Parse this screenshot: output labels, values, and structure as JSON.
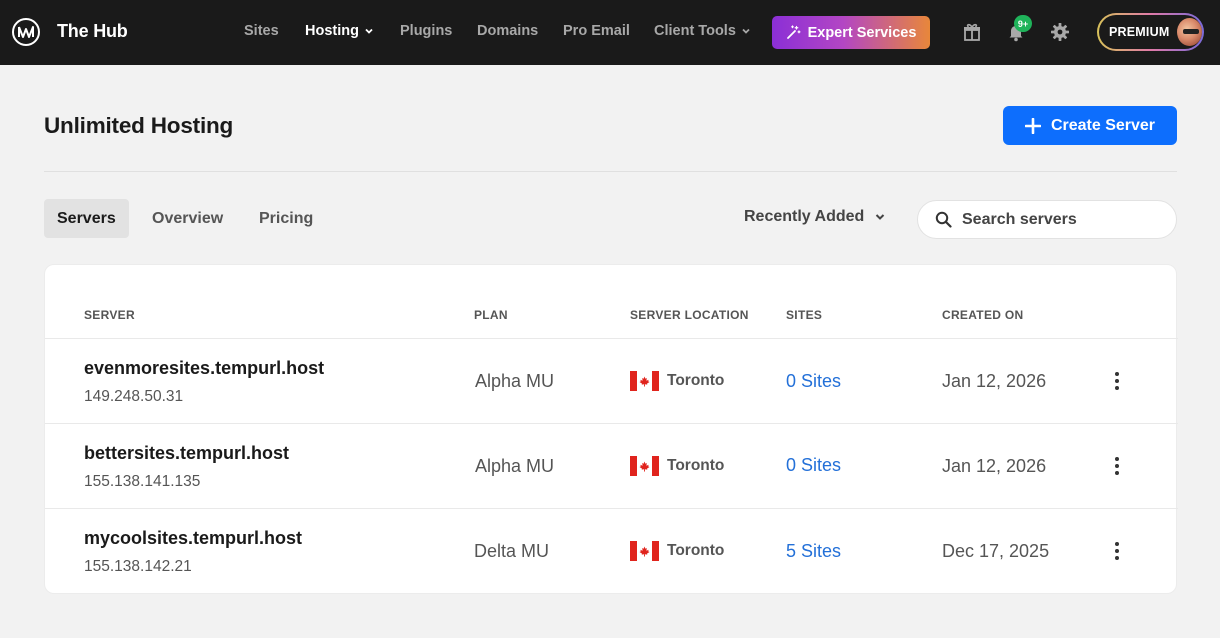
{
  "app": {
    "name": "The Hub"
  },
  "nav": {
    "items": [
      {
        "label": "Sites",
        "active": false,
        "dropdown": false
      },
      {
        "label": "Hosting",
        "active": true,
        "dropdown": true
      },
      {
        "label": "Plugins",
        "active": false,
        "dropdown": false
      },
      {
        "label": "Domains",
        "active": false,
        "dropdown": false
      },
      {
        "label": "Pro Email",
        "active": false,
        "dropdown": false
      },
      {
        "label": "Client Tools",
        "active": false,
        "dropdown": true
      }
    ],
    "expert_label": "Expert Services",
    "expert_icon": "magic-wand-icon",
    "notification_badge": "9+",
    "premium_label": "PREMIUM",
    "icons": [
      "gift-icon",
      "bell-icon",
      "gear-icon"
    ]
  },
  "page": {
    "title": "Unlimited Hosting",
    "create_label": "Create Server",
    "tabs": [
      {
        "label": "Servers",
        "active": true
      },
      {
        "label": "Overview",
        "active": false
      },
      {
        "label": "Pricing",
        "active": false
      }
    ],
    "sort_label": "Recently Added",
    "search_placeholder": "Search servers"
  },
  "table": {
    "headers": {
      "server": "SERVER",
      "plan": "PLAN",
      "location": "SERVER LOCATION",
      "sites": "SITES",
      "created": "CREATED ON"
    },
    "rows": [
      {
        "name": "evenmoresites.tempurl.host",
        "ip": "149.248.50.31",
        "plan": "Alpha MU",
        "location": "Toronto",
        "sites": "0 Sites",
        "created": "Jan 12, 2026"
      },
      {
        "name": "bettersites.tempurl.host",
        "ip": "155.138.141.135",
        "plan": "Alpha MU",
        "location": "Toronto",
        "sites": "0 Sites",
        "created": "Jan 12, 2026"
      },
      {
        "name": "mycoolsites.tempurl.host",
        "ip": "155.138.142.21",
        "plan": "Delta MU",
        "location": "Toronto",
        "sites": "5 Sites",
        "created": "Dec 17, 2025"
      }
    ]
  },
  "colors": {
    "topbar": "#1a1a1a",
    "primary": "#0d6efd",
    "link": "#2370d8",
    "badge": "#1fb35a"
  }
}
